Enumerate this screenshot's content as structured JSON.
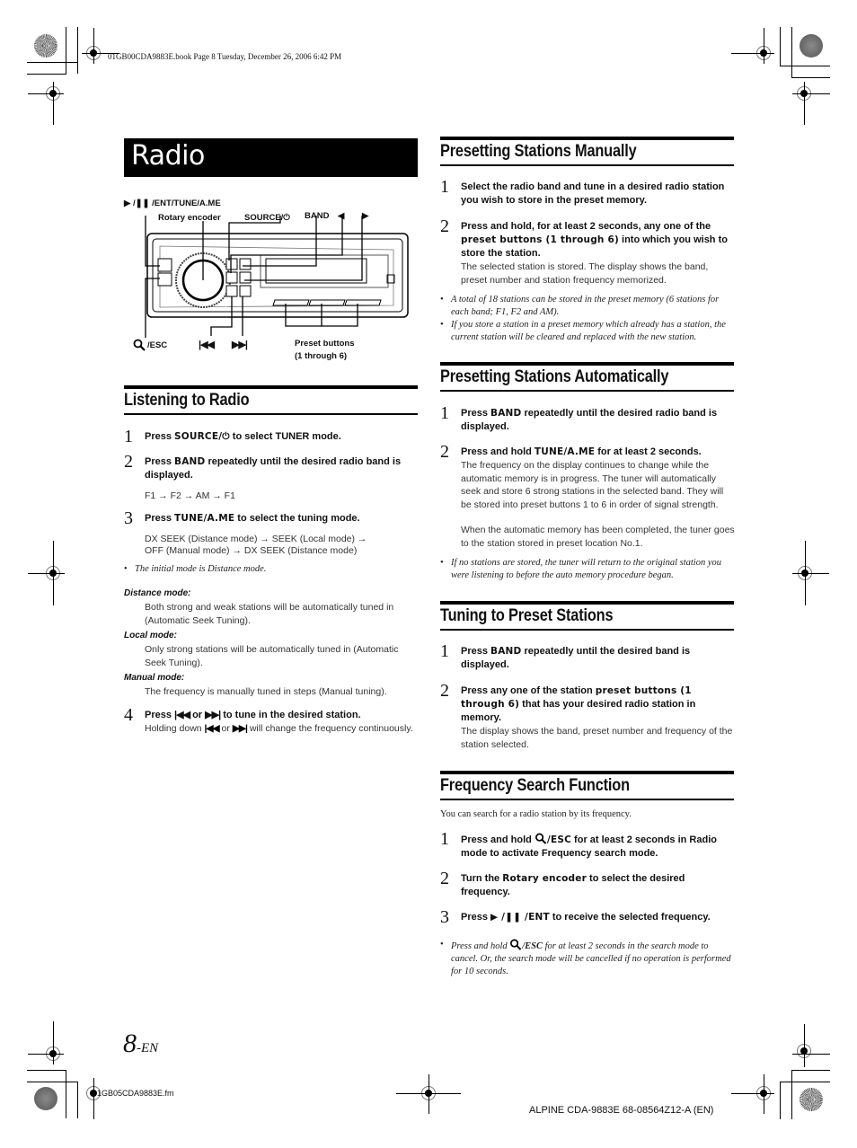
{
  "print_slug": {
    "top": "01GB00CDA9883E.book  Page 8  Tuesday, December 26, 2006  6:42 PM",
    "bottom_left": "01GB05CDA9883E.fm",
    "bottom_right": "ALPINE CDA-9883E 68-08564Z12-A (EN)"
  },
  "page_title": "Radio",
  "page_number": {
    "number": "8",
    "suffix": "-EN"
  },
  "diagram": {
    "labels": {
      "play_pause_ent": "▶ /❚❚ /ENT/TUNE/A.ME",
      "rotary_encoder": "Rotary encoder",
      "source": "SOURCE/⏻",
      "band": "BAND",
      "left_arrow": "◀",
      "right_arrow": "▶",
      "search_esc": "/ESC",
      "prev": "|◀◀",
      "next": "▶▶|",
      "preset_line1": "Preset buttons",
      "preset_line2": "(1 through 6)"
    },
    "icons": [
      "search-icon",
      "power-icon",
      "play-pause-icon",
      "skip-back-icon",
      "skip-forward-icon"
    ]
  },
  "listening": {
    "heading": "Listening to Radio",
    "steps": [
      {
        "num": "1",
        "pre": "Press ",
        "key": "SOURCE/⏻",
        "post": " to select TUNER mode."
      },
      {
        "num": "2",
        "pre": "Press ",
        "key": "BAND",
        "post": " repeatedly until the desired radio band is displayed.",
        "sub": "F1 → F2 → AM → F1"
      },
      {
        "num": "3",
        "pre": "Press ",
        "key": "TUNE/A.ME",
        "post": " to select the tuning mode.",
        "sub1": "DX SEEK (Distance mode) → SEEK (Local mode) →",
        "sub2": "OFF (Manual mode) → DX SEEK (Distance mode)"
      },
      {
        "num": "4",
        "pre": "Press ",
        "key_a": "|◀◀",
        "mid": " or ",
        "key_b": "▶▶|",
        "post": " to tune in the desired station.",
        "body_pre": "Holding down ",
        "body_mid": " or ",
        "body_post": " will change the frequency continuously."
      }
    ],
    "note": "The initial mode is Distance mode.",
    "modes": [
      {
        "title": "Distance mode:",
        "text": "Both strong and weak stations will be automatically tuned in (Automatic Seek Tuning)."
      },
      {
        "title": "Local mode:",
        "text": "Only strong stations will be automatically tuned in (Automatic Seek Tuning)."
      },
      {
        "title": "Manual mode:",
        "text": "The frequency is manually tuned in steps (Manual tuning)."
      }
    ]
  },
  "preset_manual": {
    "heading": "Presetting Stations Manually",
    "steps": [
      {
        "num": "1",
        "text": "Select the radio band and tune in a desired radio station you wish to store in the preset memory."
      },
      {
        "num": "2",
        "pre": "Press and hold, for at least 2 seconds, any one of the ",
        "key": "preset buttons (1 through 6)",
        "post": " into which you wish to store the station.",
        "body": "The selected station is stored. The display shows the band, preset number and station frequency memorized."
      }
    ],
    "notes": [
      "A total of 18 stations can be stored in the preset memory (6 stations for each band; F1, F2 and AM).",
      "If you store a station in a preset memory which already has a station, the current station will be cleared and replaced with the new station."
    ]
  },
  "preset_auto": {
    "heading": "Presetting Stations Automatically",
    "steps": [
      {
        "num": "1",
        "pre": "Press ",
        "key": "BAND",
        "post": " repeatedly until the desired radio band is displayed."
      },
      {
        "num": "2",
        "pre": "Press and hold ",
        "key": "TUNE/A.ME",
        "post": " for at least 2 seconds.",
        "body": "The frequency on the display continues to change while the automatic memory is in progress. The tuner will automatically seek and store 6 strong stations in the selected band. They will be stored into preset buttons 1 to 6 in order of signal strength.",
        "body2": "When the automatic memory has been completed, the tuner goes to the station stored in preset location No.1."
      }
    ],
    "note": "If no stations are stored, the tuner will return to the original station you were listening to before the auto memory procedure began."
  },
  "tuning_preset": {
    "heading": "Tuning to Preset Stations",
    "steps": [
      {
        "num": "1",
        "pre": "Press ",
        "key": "BAND",
        "post": " repeatedly until the desired band is displayed."
      },
      {
        "num": "2",
        "pre": "Press any one of the station ",
        "key": "preset buttons (1 through 6)",
        "post": " that has your desired radio station in memory.",
        "body": "The display shows the band, preset number and frequency of the station selected."
      }
    ]
  },
  "freq_search": {
    "heading": "Frequency Search Function",
    "intro": "You can search for a radio station by its frequency.",
    "steps": [
      {
        "num": "1",
        "pre": "Press and hold ",
        "key": "/ESC",
        "post": " for at least 2 seconds in Radio mode to activate Frequency search mode."
      },
      {
        "num": "2",
        "pre": "Turn the ",
        "key": "Rotary encoder",
        "post": " to select the desired frequency."
      },
      {
        "num": "3",
        "pre": "Press ",
        "key": "▶ /❚❚ /ENT",
        "post": " to receive the selected frequency."
      }
    ],
    "note_pre": "Press and hold ",
    "note_key": "/ESC",
    "note_post": " for at least 2 seconds in the search mode to cancel. Or, the search mode will be cancelled if no operation is performed for 10 seconds."
  }
}
